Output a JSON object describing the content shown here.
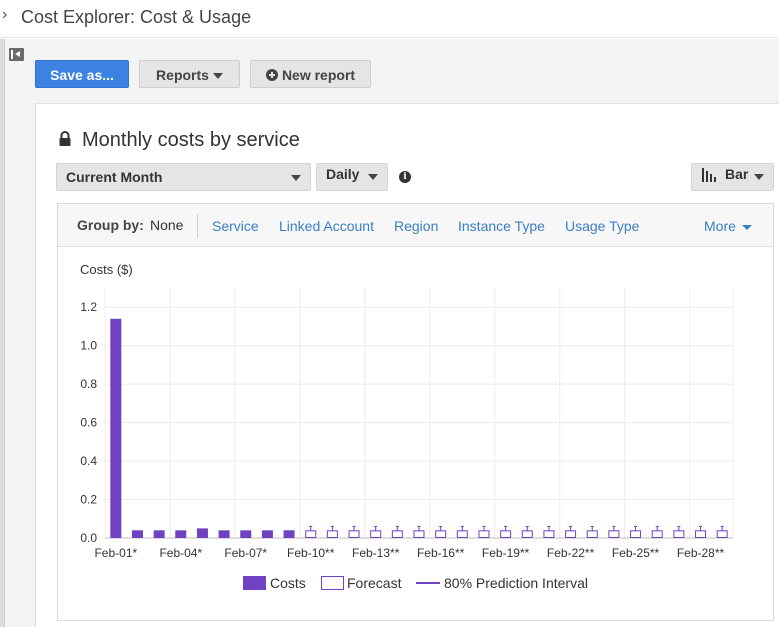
{
  "page": {
    "title": "Cost Explorer: Cost & Usage"
  },
  "toolbar": {
    "save_as_label": "Save as...",
    "reports_label": "Reports",
    "new_report_label": "New report"
  },
  "report": {
    "title": "Monthly costs by service",
    "date_range": "Current Month",
    "granularity": "Daily",
    "chart_style": "Bar"
  },
  "group_by": {
    "label": "Group by:",
    "value": "None",
    "options": [
      "Service",
      "Linked Account",
      "Region",
      "Instance Type",
      "Usage Type"
    ],
    "more_label": "More"
  },
  "colors": {
    "costs": "#6f42c1",
    "forecast_stroke": "#6f42c1",
    "primary_button": "#3b82e3",
    "link": "#3b7fc4"
  },
  "chart_data": {
    "type": "bar",
    "ylabel": "Costs ($)",
    "ylim": [
      0,
      1.3
    ],
    "yticks": [
      "0.0",
      "0.2",
      "0.4",
      "0.6",
      "0.8",
      "1.0",
      "1.2"
    ],
    "xtick_labels": [
      "Feb-01*",
      "Feb-04*",
      "Feb-07*",
      "Feb-10**",
      "Feb-13**",
      "Feb-16**",
      "Feb-19**",
      "Feb-22**",
      "Feb-25**",
      "Feb-28**"
    ],
    "xtick_days": [
      1,
      4,
      7,
      10,
      13,
      16,
      19,
      22,
      25,
      28
    ],
    "grid": true,
    "legend_position": "bottom",
    "categories": [
      "Feb-01",
      "Feb-02",
      "Feb-03",
      "Feb-04",
      "Feb-05",
      "Feb-06",
      "Feb-07",
      "Feb-08",
      "Feb-09",
      "Feb-10",
      "Feb-11",
      "Feb-12",
      "Feb-13",
      "Feb-14",
      "Feb-15",
      "Feb-16",
      "Feb-17",
      "Feb-18",
      "Feb-19",
      "Feb-20",
      "Feb-21",
      "Feb-22",
      "Feb-23",
      "Feb-24",
      "Feb-25",
      "Feb-26",
      "Feb-27",
      "Feb-28",
      "Feb-29"
    ],
    "series": [
      {
        "name": "Costs",
        "style": "filled",
        "values": [
          1.14,
          0.04,
          0.04,
          0.04,
          0.05,
          0.04,
          0.04,
          0.04,
          0.04,
          null,
          null,
          null,
          null,
          null,
          null,
          null,
          null,
          null,
          null,
          null,
          null,
          null,
          null,
          null,
          null,
          null,
          null,
          null,
          null
        ]
      },
      {
        "name": "Forecast",
        "style": "outline",
        "values": [
          null,
          null,
          null,
          null,
          null,
          null,
          null,
          null,
          null,
          0.04,
          0.04,
          0.04,
          0.04,
          0.04,
          0.04,
          0.04,
          0.04,
          0.04,
          0.04,
          0.04,
          0.04,
          0.04,
          0.04,
          0.04,
          0.04,
          0.04,
          0.04,
          0.04,
          0.04
        ]
      },
      {
        "name": "80% Prediction Interval",
        "style": "range",
        "low": [
          null,
          null,
          null,
          null,
          null,
          null,
          null,
          null,
          null,
          0.035,
          0.035,
          0.035,
          0.035,
          0.035,
          0.035,
          0.035,
          0.035,
          0.035,
          0.035,
          0.035,
          0.035,
          0.035,
          0.035,
          0.035,
          0.035,
          0.035,
          0.035,
          0.035,
          0.035
        ],
        "high": [
          null,
          null,
          null,
          null,
          null,
          null,
          null,
          null,
          null,
          0.06,
          0.06,
          0.06,
          0.06,
          0.06,
          0.06,
          0.06,
          0.06,
          0.06,
          0.06,
          0.06,
          0.06,
          0.06,
          0.06,
          0.06,
          0.06,
          0.06,
          0.06,
          0.06,
          0.06
        ]
      }
    ]
  }
}
